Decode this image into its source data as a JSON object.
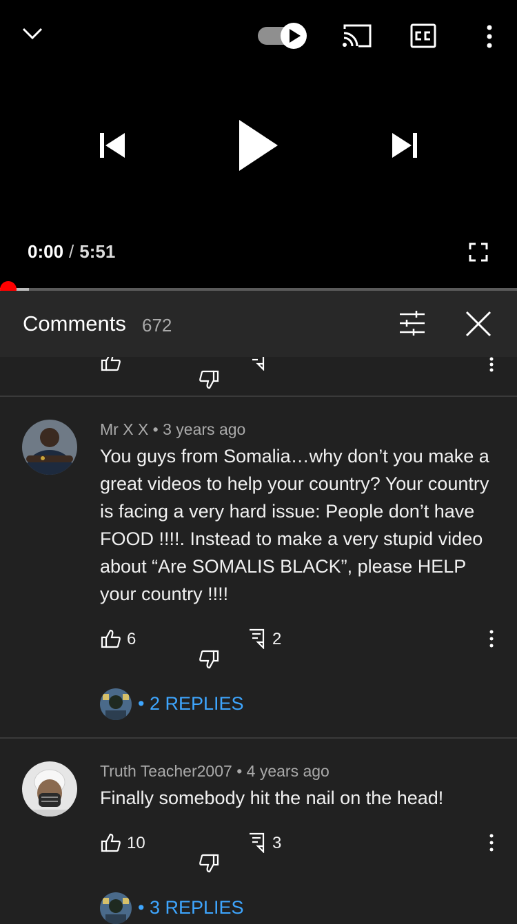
{
  "player": {
    "current_time": "0:00",
    "separator": "/",
    "duration": "5:51",
    "progress_fraction": 0.0,
    "buffered_fraction": 0.056,
    "autoplay_on": true
  },
  "comments_panel": {
    "title": "Comments",
    "count": "672"
  },
  "comments": [
    {
      "author": "Mr X X",
      "dot": "•",
      "age": "3 years ago",
      "text": "You guys from Somalia…why don’t you make a great videos to help your country? Your country is facing a very hard issue: People don’t have FOOD !!!!. Instead to make a very stupid video about “Are SOMALIS BLACK”, please HELP your country !!!!",
      "likes": "6",
      "reply_count": "2",
      "replies_dot": "•",
      "replies_label": "2 REPLIES"
    },
    {
      "author": "Truth Teacher2007",
      "dot": "•",
      "age": "4 years ago",
      "text": "Finally somebody hit the nail on the head!",
      "likes": "10",
      "reply_count": "3",
      "replies_dot": "•",
      "replies_label": "3 REPLIES"
    }
  ],
  "icons": {
    "collapse": "chevron-down-icon",
    "autoplay": "autoplay-toggle-icon",
    "cast": "cast-icon",
    "captions": "cc-icon",
    "more": "more-vert-icon",
    "previous": "skip-previous-icon",
    "play": "play-icon",
    "next": "skip-next-icon",
    "fullscreen": "fullscreen-icon",
    "sort": "sort-filter-icon",
    "close": "close-icon",
    "like": "thumbs-up-icon",
    "dislike": "thumbs-down-icon",
    "reply": "reply-icon"
  },
  "colors": {
    "accent_red": "#ff0000",
    "link_blue": "#3ea6ff",
    "panel_bg": "#212121",
    "header_bg": "#282828"
  }
}
